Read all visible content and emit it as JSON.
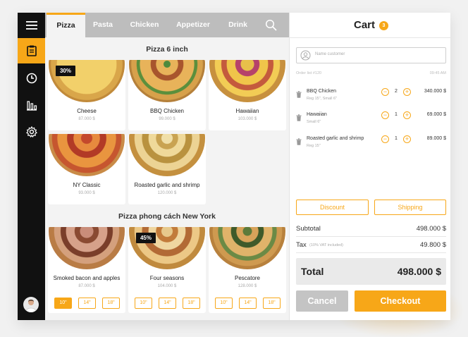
{
  "colors": {
    "accent": "#f7a718",
    "sidebar": "#111111",
    "tab_bar": "#bdbdbd",
    "disabled": "#c4c4c4"
  },
  "sidebar": {
    "items": [
      {
        "icon": "hamburger-menu-icon"
      },
      {
        "icon": "clipboard-icon",
        "active": true
      },
      {
        "icon": "clock-icon"
      },
      {
        "icon": "bar-chart-icon"
      },
      {
        "icon": "gear-icon"
      }
    ],
    "avatar_icon": "avatar"
  },
  "tabs": [
    {
      "label": "Pizza",
      "active": true
    },
    {
      "label": "Pasta"
    },
    {
      "label": "Chicken"
    },
    {
      "label": "Appetizer"
    },
    {
      "label": "Drink"
    }
  ],
  "search_icon": "search-icon",
  "sections": [
    {
      "title": "Pizza 6 inch",
      "products": [
        {
          "name": "Cheese",
          "price": "87.000 $",
          "badge": "30%"
        },
        {
          "name": "BBQ Chicken",
          "price": "99.000 $"
        },
        {
          "name": "Hawaiian",
          "price": "103.000 $"
        },
        {
          "name": "NY Classic",
          "price": "93.000 $"
        },
        {
          "name": "Roasted garlic and shrimp",
          "price": "120.000 $"
        }
      ]
    },
    {
      "title": "Pizza phong cách New York",
      "products": [
        {
          "name": "Smoked bacon and apples",
          "price": "87.000 $",
          "sizes": [
            "10\"",
            "14\"",
            "18\""
          ],
          "selected_size": "10\""
        },
        {
          "name": "Four seasons",
          "price": "104.000 $",
          "badge": "45%",
          "sizes": [
            "10\"",
            "14\"",
            "18\""
          ]
        },
        {
          "name": "Pescatore",
          "price": "128.000 $",
          "sizes": [
            "10\"",
            "14\"",
            "18\""
          ]
        }
      ]
    }
  ],
  "cart": {
    "title": "Cart",
    "count": "3",
    "customer_placeholder": "Name customer",
    "order_label": "Order list #120",
    "time": "09:45 AM",
    "items": [
      {
        "name": "BBQ Chicken",
        "options": "Reg 15\", Small 6\"",
        "qty": "2",
        "price": "340.000 $"
      },
      {
        "name": "Hawaiian",
        "options": "Small 6\"",
        "qty": "1",
        "price": "69.000 $"
      },
      {
        "name": "Roasted garlic and shrimp",
        "options": "Reg 15\"",
        "qty": "1",
        "price": "89.000 $"
      }
    ],
    "discount_label": "Discount",
    "shipping_label": "Shipping",
    "subtotal_label": "Subtotal",
    "subtotal": "498.000 $",
    "tax_label": "Tax",
    "tax_note": "(10% VAT included)",
    "tax": "49.800 $",
    "total_label": "Total",
    "total": "498.000 $",
    "cancel_label": "Cancel",
    "checkout_label": "Checkout"
  }
}
